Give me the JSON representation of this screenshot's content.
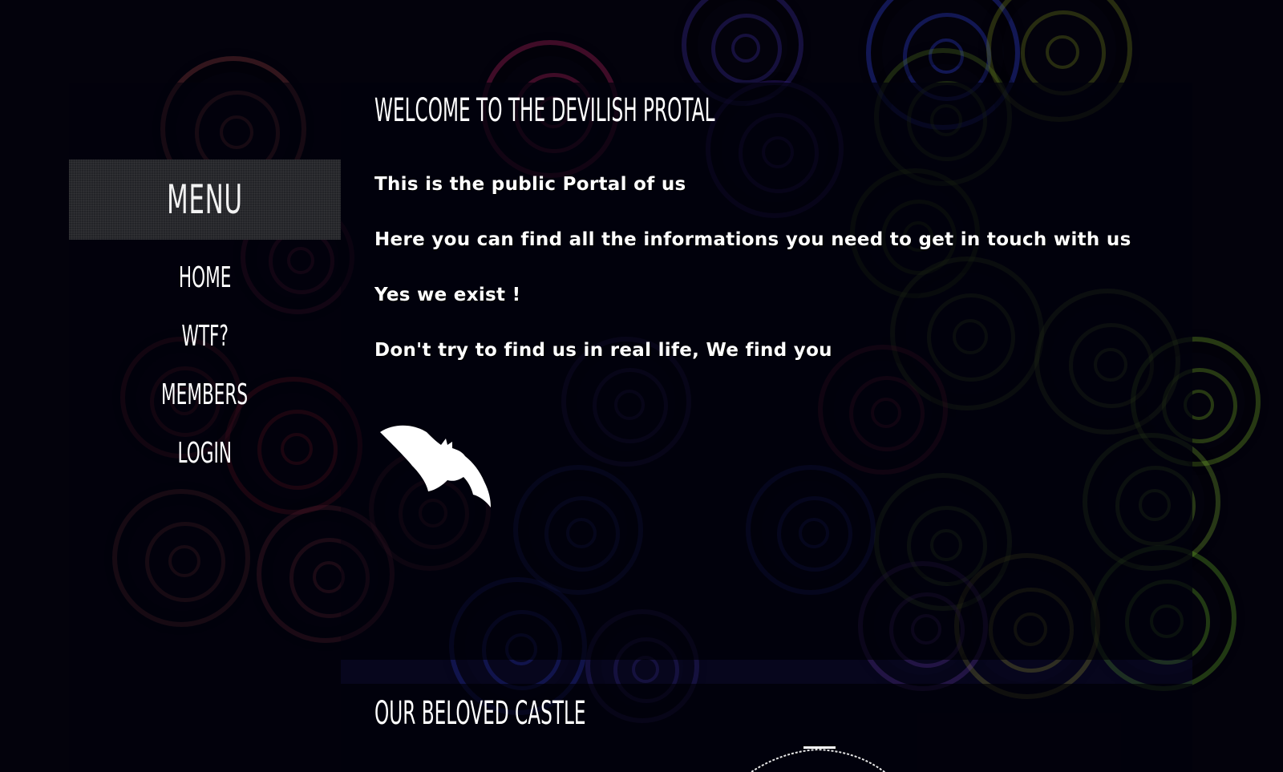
{
  "sidebar": {
    "menu_title": "MENU",
    "items": [
      {
        "label": "HOME"
      },
      {
        "label": "WTF?"
      },
      {
        "label": "MEMBERS"
      },
      {
        "label": "LOGIN"
      }
    ]
  },
  "main": {
    "welcome_title": "WELCOME TO THE DEVILISH PROTAL",
    "paragraphs": [
      "This is the public Portal of us",
      "Here you can find all the informations you need to get in touch with us",
      "Yes we exist !",
      "Don't try to find us in real life, We find you"
    ],
    "castle_title": "OUR BELOVED CASTLE"
  },
  "icons": {
    "bat": "bat-icon",
    "castle": "castle-icon"
  },
  "colors": {
    "background": "#03020c",
    "text": "#ffffff",
    "menu_header_bg": "#232428"
  }
}
